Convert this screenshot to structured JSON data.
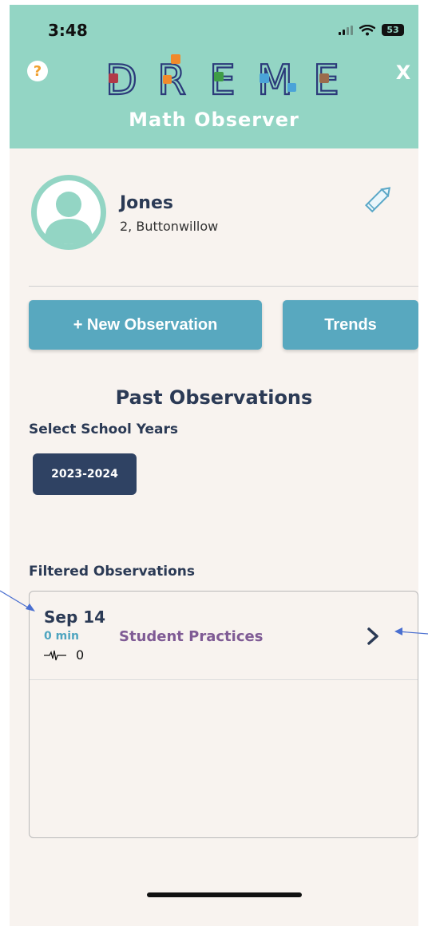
{
  "status_bar": {
    "time": "3:48",
    "battery": "53"
  },
  "header": {
    "help_label": "?",
    "close_label": "X",
    "logo_letters": [
      "D",
      "R",
      "E",
      "M",
      "E"
    ],
    "subtitle": "Math Observer"
  },
  "profile": {
    "name": "Jones",
    "details": "2, Buttonwillow"
  },
  "actions": {
    "new_observation": "+ New Observation",
    "trends": "Trends"
  },
  "past_observations": {
    "title": "Past Observations",
    "school_years_label": "Select School Years",
    "selected_year": "2023-2024",
    "filtered_label": "Filtered Observations",
    "items": [
      {
        "date": "Sep 14",
        "duration": "0 min",
        "count": "0",
        "category": "Student Practices"
      }
    ]
  },
  "colors": {
    "header_bg": "#93d5c4",
    "page_bg": "#f8f3ef",
    "button_bg": "#58a8bf",
    "navy": "#2b3a55",
    "chip_bg": "#2f4263",
    "category_purple": "#7f5b95",
    "duration_blue": "#4fa5c0",
    "annotation_arrow": "#4a6fd0"
  },
  "icons": {
    "help": "question-circle-icon",
    "close": "close-icon",
    "avatar": "user-silhouette-icon",
    "edit": "pencil-icon",
    "pulse": "heartbeat-icon",
    "chevron": "chevron-right-icon"
  }
}
